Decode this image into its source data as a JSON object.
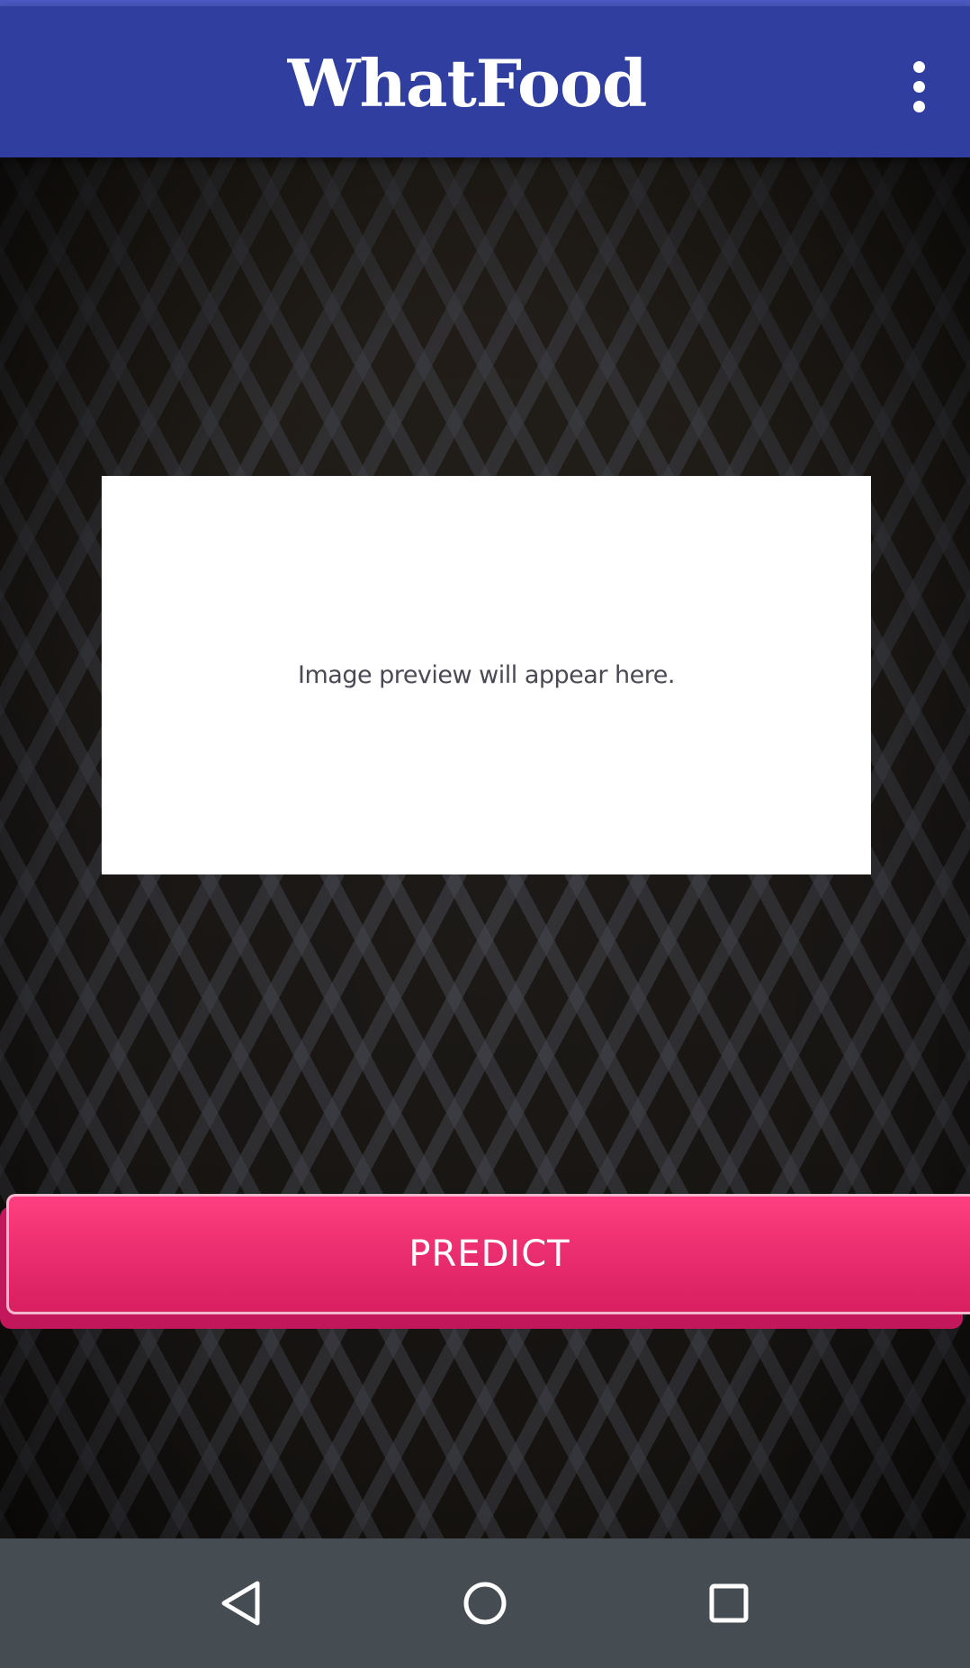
{
  "app": {
    "title": "WhatFood",
    "colors": {
      "app_bar": "#303f9f",
      "accent_button": "#ff4081",
      "nav_bar": "#454c52"
    }
  },
  "toolbar": {
    "overflow_icon": "more-vert-icon"
  },
  "preview": {
    "placeholder_text": "Image preview will appear here."
  },
  "actions": {
    "predict_label": "PREDICT"
  },
  "navigation": {
    "back_icon": "back-triangle-icon",
    "home_icon": "home-circle-icon",
    "recents_icon": "recents-square-icon"
  }
}
